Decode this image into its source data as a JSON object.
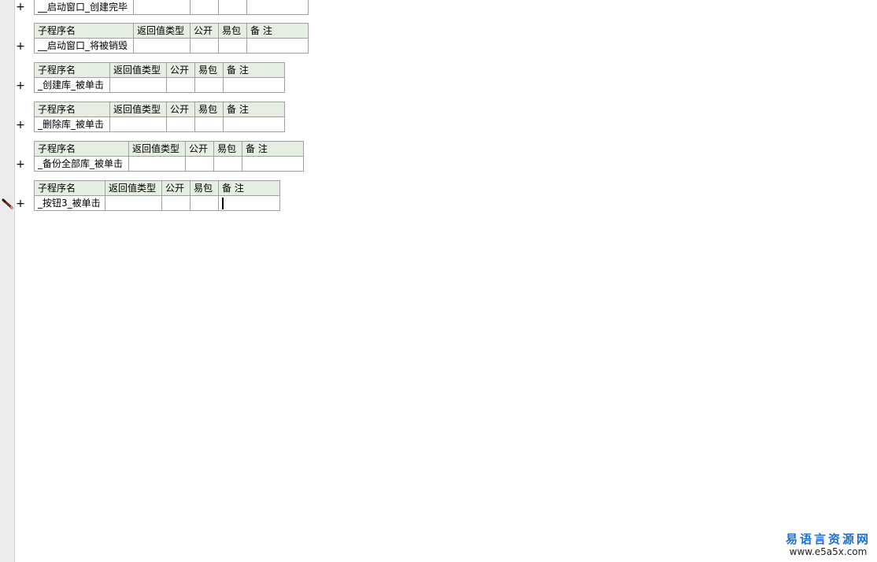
{
  "headers": {
    "name": "子程序名",
    "return_type": "返回值类型",
    "public": "公开",
    "package": "易包",
    "remark": "备 注"
  },
  "expand_symbol": "+",
  "subroutines": [
    {
      "name": "__启动窗口_创建完毕"
    },
    {
      "name": "__启动窗口_将被销毁"
    },
    {
      "name": "_创建库_被单击"
    },
    {
      "name": "_删除库_被单击"
    },
    {
      "name": "_备份全部库_被单击"
    },
    {
      "name": "_按钮3_被单击"
    }
  ],
  "watermark": {
    "title": "易语言资源网",
    "url": "www.e5a5x.com"
  },
  "colors": {
    "header_bg": "#e6ede3",
    "border": "#a0a0a0",
    "watermark_blue": "#1b6fd1"
  }
}
